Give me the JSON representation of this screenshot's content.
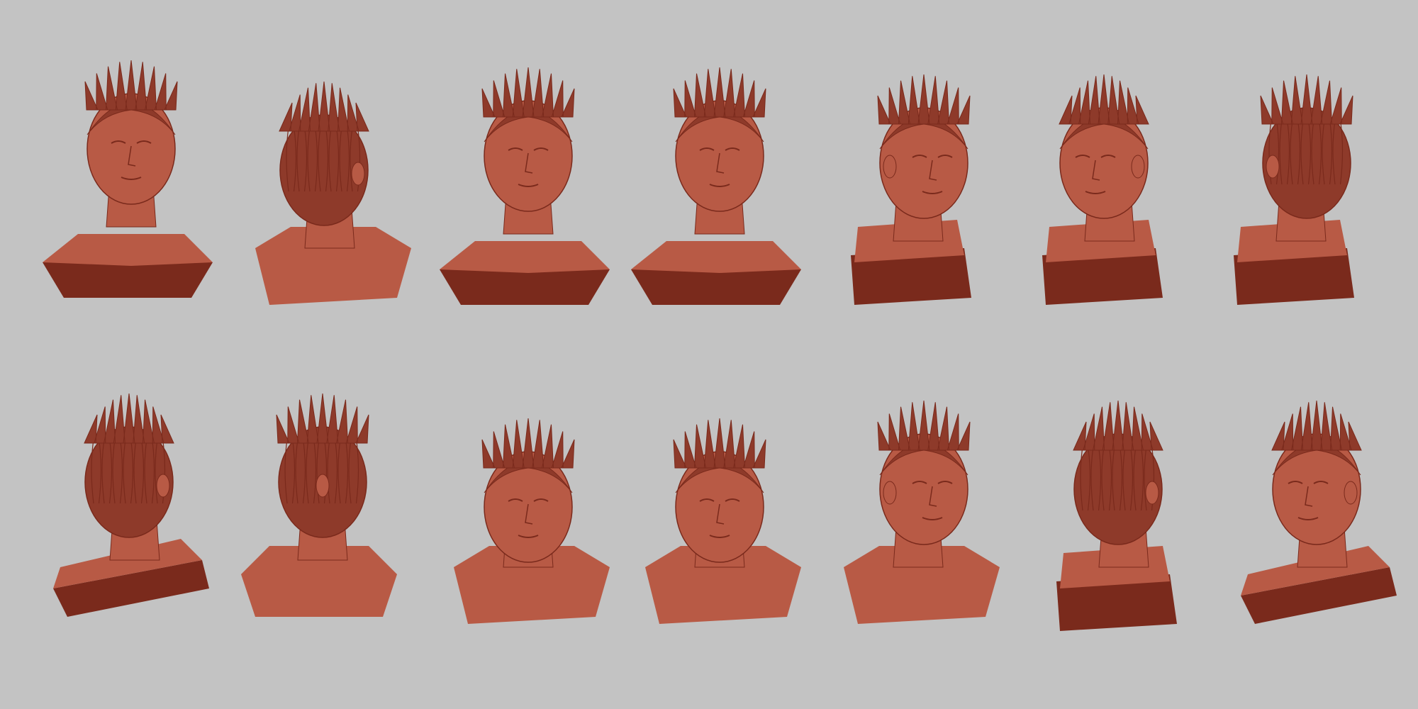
{
  "scene": {
    "background": "#c3c3c3",
    "clay_color": "#b85a45",
    "clay_dark": "#7a2a1c",
    "hair_color": "#8e3a2a",
    "subject": "clay-sculpt-bust-turnaround"
  },
  "views": [
    {
      "id": "front-up",
      "facing": "front",
      "base": "hex"
    },
    {
      "id": "left-3q-back",
      "facing": "left-back",
      "base": "none"
    },
    {
      "id": "front-2",
      "facing": "front",
      "base": "hex"
    },
    {
      "id": "front-3",
      "facing": "front",
      "base": "hex-light"
    },
    {
      "id": "right-profile",
      "facing": "right",
      "base": "block"
    },
    {
      "id": "left-3q",
      "facing": "left",
      "base": "block"
    },
    {
      "id": "back-right",
      "facing": "back-right",
      "base": "block"
    },
    {
      "id": "back-left",
      "facing": "back-left",
      "base": "slant"
    },
    {
      "id": "back",
      "facing": "back",
      "base": "flat"
    },
    {
      "id": "front-down",
      "facing": "front-down",
      "base": "chest"
    },
    {
      "id": "front-down-tilt",
      "facing": "front-down-tilt",
      "base": "chest"
    },
    {
      "id": "right-3q-low",
      "facing": "right",
      "base": "chest"
    },
    {
      "id": "left-back-low",
      "facing": "left-back",
      "base": "block"
    },
    {
      "id": "left-profile-low",
      "facing": "left",
      "base": "slant"
    }
  ]
}
